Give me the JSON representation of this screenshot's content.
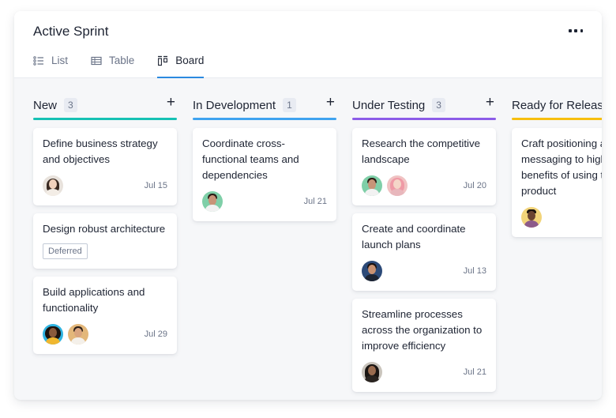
{
  "header": {
    "title": "Active Sprint",
    "more_icon": "more-horizontal-icon"
  },
  "tabs": [
    {
      "label": "List",
      "icon": "list-icon",
      "active": false
    },
    {
      "label": "Table",
      "icon": "table-icon",
      "active": false
    },
    {
      "label": "Board",
      "icon": "board-icon",
      "active": true
    }
  ],
  "columns": [
    {
      "name": "New",
      "count": "3",
      "color": "#16c1b4",
      "cards": [
        {
          "title": "Define business strategy and objectives",
          "date": "Jul 15",
          "avatars": [
            "woman-light-long-hair"
          ]
        },
        {
          "title": "Design robust architecture",
          "tag": "Deferred"
        },
        {
          "title": "Build applications and functionality",
          "date": "Jul 29",
          "avatars": [
            "woman-curly-hair",
            "man-glasses"
          ]
        }
      ]
    },
    {
      "name": "In Development",
      "count": "1",
      "color": "#3fa3ef",
      "cards": [
        {
          "title": "Coordinate cross-functional teams and dependencies",
          "date": "Jul 21",
          "avatars": [
            "man-beard"
          ]
        }
      ]
    },
    {
      "name": "Under Testing",
      "count": "3",
      "color": "#8c5ce8",
      "cards": [
        {
          "title": "Research the competitive landscape",
          "date": "Jul 20",
          "avatars": [
            "man-beard",
            "woman-pink-hair"
          ]
        },
        {
          "title": "Create and coordinate launch plans",
          "date": "Jul 13",
          "avatars": [
            "man-suit"
          ]
        },
        {
          "title": "Streamline processes across the organization to improve efficiency",
          "date": "Jul 21",
          "avatars": [
            "woman-dark-hair"
          ]
        }
      ]
    },
    {
      "name": "Ready for Release",
      "color": "#f7bf0f",
      "cards": [
        {
          "title": "Craft positioning and messaging to highlight the benefits of using the product",
          "avatars": [
            "man-smiling"
          ]
        }
      ]
    }
  ],
  "add_icon": "plus-icon"
}
